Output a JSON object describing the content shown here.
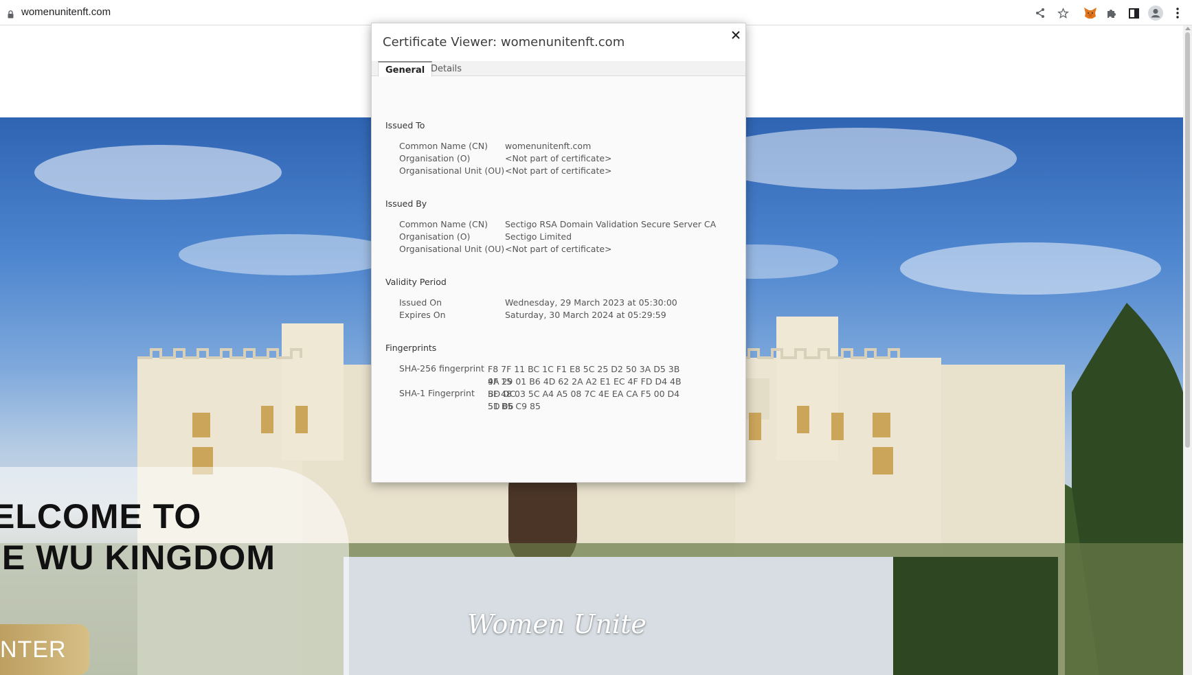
{
  "browser": {
    "url": "womenunitenft.com",
    "toolbar_icons": [
      "share-icon",
      "bookmark-star-icon",
      "metamask-fox-icon",
      "extensions-puzzle-icon",
      "side-panel-icon",
      "profile-avatar-icon",
      "more-menu-icon"
    ]
  },
  "page": {
    "welcome_line1": "ELCOME TO",
    "welcome_line2": "IE WU KINGDOM",
    "enter_label": "NTER",
    "brand_script": "Women Unite",
    "accent_gold": "#c9ad6f"
  },
  "dialog": {
    "title": "Certificate Viewer: womenunitenft.com",
    "tabs": [
      {
        "label": "General",
        "active": true
      },
      {
        "label": "Details",
        "active": false
      }
    ],
    "issued_to": {
      "heading": "Issued To",
      "rows": [
        {
          "label": "Common Name (CN)",
          "value": "womenunitenft.com"
        },
        {
          "label": "Organisation (O)",
          "value": "<Not part of certificate>"
        },
        {
          "label": "Organisational Unit (OU)",
          "value": "<Not part of certificate>"
        }
      ]
    },
    "issued_by": {
      "heading": "Issued By",
      "rows": [
        {
          "label": "Common Name (CN)",
          "value": "Sectigo RSA Domain Validation Secure Server CA"
        },
        {
          "label": "Organisation (O)",
          "value": "Sectigo Limited"
        },
        {
          "label": "Organisational Unit (OU)",
          "value": "<Not part of certificate>"
        }
      ]
    },
    "validity": {
      "heading": "Validity Period",
      "rows": [
        {
          "label": "Issued On",
          "value": "Wednesday, 29 March 2023 at 05:30:00"
        },
        {
          "label": "Expires On",
          "value": "Saturday, 30 March 2024 at 05:29:59"
        }
      ]
    },
    "fingerprints": {
      "heading": "Fingerprints",
      "rows": [
        {
          "label": "SHA-256 fingerprint",
          "line1": "F8 7F 11 BC 1C F1 E8 5C 25 D2 50 3A D5 3B 4F 15",
          "line2": "9A 29 01 B6 4D 62 2A A2 E1 EC 4F FD D4 4B BD DC"
        },
        {
          "label": "SHA-1 Fingerprint",
          "line1": "5F 48 03 5C A4 A5 08 7C 4E EA CA F5 00 D4 5D 06",
          "line2": "51 B5 C9 85"
        }
      ]
    }
  }
}
